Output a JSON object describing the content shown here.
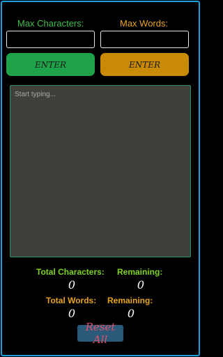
{
  "limits": {
    "max_characters_label": "Max Characters:",
    "max_words_label": "Max Words:",
    "max_characters_value": "",
    "max_words_value": "",
    "enter_characters_label": "ENTER",
    "enter_words_label": "ENTER"
  },
  "editor": {
    "placeholder": "Start typing...",
    "value": ""
  },
  "stats": {
    "total_characters_label": "Total Characters:",
    "total_characters_value": "0",
    "remaining_characters_label": "Remaining:",
    "remaining_characters_value": "0",
    "total_words_label": "Total Words:",
    "total_words_value": "0",
    "remaining_words_label": "Remaining:",
    "remaining_words_value": "0"
  },
  "reset_label": "Reset All",
  "colors": {
    "frame_border": "#1f9fd8",
    "chars_accent": "#3dbd4a",
    "words_accent": "#e8a41c",
    "enter_chars_bg": "#1ea34a",
    "enter_words_bg": "#c98a05",
    "editor_bg": "#413f3a",
    "reset_bg": "#2a5a78",
    "reset_text": "#e0506a"
  }
}
